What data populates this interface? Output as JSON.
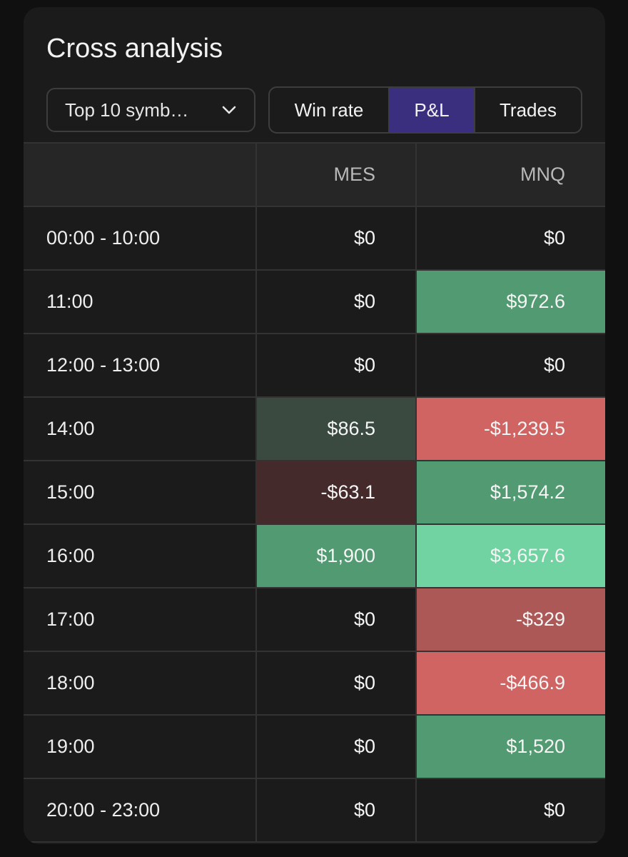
{
  "title": "Cross analysis",
  "filter": {
    "selected": "Top 10 symb…"
  },
  "metric_tabs": [
    {
      "label": "Win rate",
      "active": false
    },
    {
      "label": "P&L",
      "active": true
    },
    {
      "label": "Trades",
      "active": false
    }
  ],
  "colors": {
    "neutral": "#1b1b1b",
    "green_light": "#3a4a40",
    "green_mid": "#519a72",
    "green_bright": "#70d3a1",
    "red_dark": "#452a2c",
    "red_mid": "#ac5856",
    "red_bright": "#cf6463",
    "active_tab": "#3a2f7f"
  },
  "table": {
    "header": [
      "",
      "MES",
      "MNQ"
    ],
    "rows": [
      {
        "label": "00:00 - 10:00",
        "cells": [
          {
            "value": "$0",
            "tone": "neutral"
          },
          {
            "value": "$0",
            "tone": "neutral"
          }
        ]
      },
      {
        "label": "11:00",
        "cells": [
          {
            "value": "$0",
            "tone": "neutral"
          },
          {
            "value": "$972.6",
            "tone": "green_mid"
          }
        ]
      },
      {
        "label": "12:00 - 13:00",
        "cells": [
          {
            "value": "$0",
            "tone": "neutral"
          },
          {
            "value": "$0",
            "tone": "neutral"
          }
        ]
      },
      {
        "label": "14:00",
        "cells": [
          {
            "value": "$86.5",
            "tone": "green_light"
          },
          {
            "value": "-$1,239.5",
            "tone": "red_bright"
          }
        ]
      },
      {
        "label": "15:00",
        "cells": [
          {
            "value": "-$63.1",
            "tone": "red_dark"
          },
          {
            "value": "$1,574.2",
            "tone": "green_mid"
          }
        ]
      },
      {
        "label": "16:00",
        "cells": [
          {
            "value": "$1,900",
            "tone": "green_mid"
          },
          {
            "value": "$3,657.6",
            "tone": "green_bright"
          }
        ]
      },
      {
        "label": "17:00",
        "cells": [
          {
            "value": "$0",
            "tone": "neutral"
          },
          {
            "value": "-$329",
            "tone": "red_mid"
          }
        ]
      },
      {
        "label": "18:00",
        "cells": [
          {
            "value": "$0",
            "tone": "neutral"
          },
          {
            "value": "-$466.9",
            "tone": "red_bright"
          }
        ]
      },
      {
        "label": "19:00",
        "cells": [
          {
            "value": "$0",
            "tone": "neutral"
          },
          {
            "value": "$1,520",
            "tone": "green_mid"
          }
        ]
      },
      {
        "label": "20:00 - 23:00",
        "cells": [
          {
            "value": "$0",
            "tone": "neutral"
          },
          {
            "value": "$0",
            "tone": "neutral"
          }
        ]
      }
    ]
  }
}
